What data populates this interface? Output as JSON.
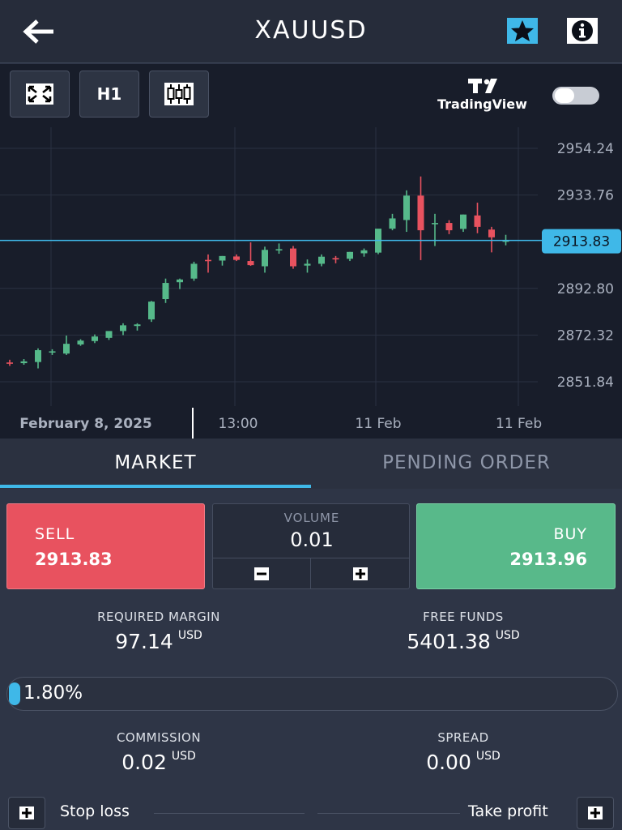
{
  "header": {
    "title": "XAUUSD",
    "back_icon": "arrow-left-icon",
    "favorite_icon": "star-icon",
    "info_icon": "info-icon",
    "favorite_color": "#3fb8e8"
  },
  "toolbar": {
    "fullscreen_icon": "expand-icon",
    "timeframe_label": "H1",
    "chart_type_icon": "candlestick-icon",
    "tradingview_label": "TradingView",
    "toggle_on": false
  },
  "chart_data": {
    "type": "candlestick",
    "price_ticks": [
      "2954.24",
      "2933.76",
      "2892.80",
      "2872.32",
      "2851.84"
    ],
    "price_tick_values": [
      2954.24,
      2933.76,
      2892.8,
      2872.32,
      2851.84
    ],
    "current_price": "2913.83",
    "current_price_value": 2913.83,
    "time_labels": [
      "February 8, 2025",
      "13:00",
      "11 Feb",
      "11 Feb"
    ],
    "candles": [
      {
        "o": 2860.3,
        "h": 2861.5,
        "l": 2858.8,
        "c": 2860.0
      },
      {
        "o": 2860.0,
        "h": 2861.8,
        "l": 2859.3,
        "c": 2860.8
      },
      {
        "o": 2860.5,
        "h": 2866.5,
        "l": 2857.7,
        "c": 2865.7
      },
      {
        "o": 2864.8,
        "h": 2866.1,
        "l": 2863.6,
        "c": 2865.2
      },
      {
        "o": 2864.2,
        "h": 2872.1,
        "l": 2863.6,
        "c": 2868.5
      },
      {
        "o": 2868.2,
        "h": 2870.5,
        "l": 2867.6,
        "c": 2869.9
      },
      {
        "o": 2869.7,
        "h": 2872.6,
        "l": 2868.8,
        "c": 2871.7
      },
      {
        "o": 2871.1,
        "h": 2873.5,
        "l": 2870.2,
        "c": 2874.1
      },
      {
        "o": 2874.1,
        "h": 2877.5,
        "l": 2872.3,
        "c": 2876.6
      },
      {
        "o": 2876.3,
        "h": 2877.5,
        "l": 2874.3,
        "c": 2877.0
      },
      {
        "o": 2879.2,
        "h": 2887.3,
        "l": 2878.1,
        "c": 2887.0
      },
      {
        "o": 2888.1,
        "h": 2897.1,
        "l": 2886.4,
        "c": 2895.2
      },
      {
        "o": 2895.5,
        "h": 2897.1,
        "l": 2892.5,
        "c": 2896.7
      },
      {
        "o": 2897.1,
        "h": 2904.5,
        "l": 2896.1,
        "c": 2903.6
      },
      {
        "o": 2905.3,
        "h": 2907.7,
        "l": 2899.7,
        "c": 2905.0
      },
      {
        "o": 2905.0,
        "h": 2907.0,
        "l": 2902.8,
        "c": 2907.0
      },
      {
        "o": 2906.8,
        "h": 2907.7,
        "l": 2904.8,
        "c": 2905.3
      },
      {
        "o": 2904.8,
        "h": 2913.0,
        "l": 2902.7,
        "c": 2903.0
      },
      {
        "o": 2902.5,
        "h": 2911.1,
        "l": 2899.7,
        "c": 2909.7
      },
      {
        "o": 2909.7,
        "h": 2912.5,
        "l": 2908.0,
        "c": 2910.0
      },
      {
        "o": 2910.3,
        "h": 2911.4,
        "l": 2901.4,
        "c": 2902.5
      },
      {
        "o": 2902.8,
        "h": 2905.5,
        "l": 2899.7,
        "c": 2903.6
      },
      {
        "o": 2903.6,
        "h": 2907.7,
        "l": 2902.5,
        "c": 2906.7
      },
      {
        "o": 2906.1,
        "h": 2907.0,
        "l": 2903.8,
        "c": 2905.5
      },
      {
        "o": 2905.8,
        "h": 2908.8,
        "l": 2904.8,
        "c": 2908.8
      },
      {
        "o": 2908.2,
        "h": 2910.3,
        "l": 2906.7,
        "c": 2909.5
      },
      {
        "o": 2908.5,
        "h": 2916.0,
        "l": 2907.8,
        "c": 2919.0
      },
      {
        "o": 2919.0,
        "h": 2925.5,
        "l": 2918.3,
        "c": 2923.5
      },
      {
        "o": 2922.8,
        "h": 2935.8,
        "l": 2917.6,
        "c": 2933.5
      },
      {
        "o": 2933.5,
        "h": 2941.9,
        "l": 2905.2,
        "c": 2918.3
      },
      {
        "o": 2921.1,
        "h": 2925.5,
        "l": 2911.4,
        "c": 2921.5
      },
      {
        "o": 2921.5,
        "h": 2922.7,
        "l": 2916.6,
        "c": 2918.3
      },
      {
        "o": 2918.9,
        "h": 2925.2,
        "l": 2917.6,
        "c": 2925.2
      },
      {
        "o": 2924.8,
        "h": 2930.4,
        "l": 2917.0,
        "c": 2919.8
      },
      {
        "o": 2918.6,
        "h": 2919.8,
        "l": 2908.6,
        "c": 2915.2
      },
      {
        "o": 2913.3,
        "h": 2916.3,
        "l": 2911.7,
        "c": 2913.8
      }
    ]
  },
  "tabs": [
    {
      "label": "MARKET",
      "active": true
    },
    {
      "label": "PENDING ORDER",
      "active": false
    }
  ],
  "trade": {
    "sell_label": "SELL",
    "sell_price": "2913.83",
    "buy_label": "BUY",
    "buy_price": "2913.96",
    "volume_label": "VOLUME",
    "volume_value": "0.01",
    "minus_icon": "minus-icon",
    "plus_icon": "plus-icon",
    "sell_color": "#e8525f",
    "buy_color": "#58b98a"
  },
  "stats": {
    "required_margin_label": "REQUIRED MARGIN",
    "required_margin_value": "97.14",
    "required_margin_unit": "USD",
    "free_funds_label": "FREE FUNDS",
    "free_funds_value": "5401.38",
    "free_funds_unit": "USD",
    "commission_label": "COMMISSION",
    "commission_value": "0.02",
    "commission_unit": "USD",
    "spread_label": "SPREAD",
    "spread_value": "0.00",
    "spread_unit": "USD"
  },
  "margin_usage": {
    "text": "1.80%",
    "fraction": 0.018
  },
  "stop_loss_label": "Stop loss",
  "take_profit_label": "Take profit",
  "accent_color": "#3fb8e8"
}
